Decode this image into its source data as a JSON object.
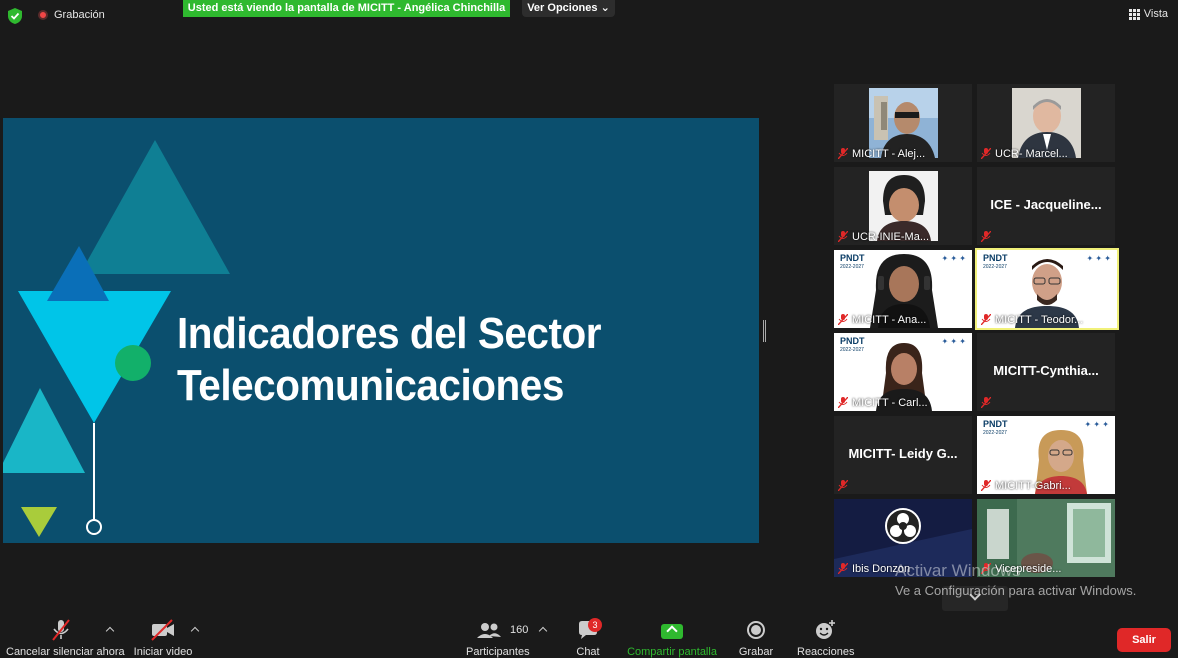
{
  "topbar": {
    "recording_label": "Grabación",
    "share_banner": "Usted está viendo la pantalla de MICITT - Angélica Chinchilla",
    "view_options": "Ver Opciones",
    "view_label": "Vista"
  },
  "slide": {
    "title_line1": "Indicadores del Sector",
    "title_line2": "Telecomunicaciones",
    "background": "#0b4f6e"
  },
  "participants": [
    {
      "name": "MICITT - Alej...",
      "type": "photo"
    },
    {
      "name": "UCR- Marcel...",
      "type": "photo"
    },
    {
      "name": "UCR-INIE-Ma...",
      "type": "photo"
    },
    {
      "name": "ICE - Jacqueline...",
      "type": "name-only"
    },
    {
      "name": "MICITT - Ana...",
      "type": "video"
    },
    {
      "name": "MICITT - Teodor...",
      "type": "video",
      "active": true
    },
    {
      "name": "MICITT - Carl...",
      "type": "video"
    },
    {
      "name": "MICITT-Cynthia...",
      "type": "name-only"
    },
    {
      "name": "MICITT- Leidy G...",
      "type": "name-only"
    },
    {
      "name": "MICITT-Gabri...",
      "type": "video"
    },
    {
      "name": "Ibis Donzon",
      "type": "obs"
    },
    {
      "name": "Vicepreside...",
      "type": "photo"
    }
  ],
  "pndt": {
    "logo": "PNDT",
    "years": "2022-2027"
  },
  "watermark": {
    "line1": "Activar Windows",
    "line2": "Ve a Configuración para activar Windows."
  },
  "toolbar": {
    "unmute_label": "Cancelar silenciar ahora",
    "start_video_label": "Iniciar video",
    "participants_label": "Participantes",
    "participants_count": "160",
    "chat_label": "Chat",
    "chat_badge": "3",
    "share_label": "Compartir pantalla",
    "record_label": "Grabar",
    "reactions_label": "Reacciones",
    "leave_label": "Salir"
  },
  "colors": {
    "accent_green": "#2fb92f",
    "leave_red": "#e02828",
    "active_speaker": "#f1f17a"
  }
}
